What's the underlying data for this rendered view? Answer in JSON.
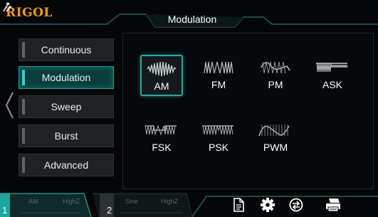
{
  "header": {
    "brand": "RIGOL",
    "title": "Modulation"
  },
  "nav": {
    "items": [
      {
        "label": "Continuous",
        "active": false
      },
      {
        "label": "Modulation",
        "active": true
      },
      {
        "label": "Sweep",
        "active": false
      },
      {
        "label": "Burst",
        "active": false
      },
      {
        "label": "Advanced",
        "active": false
      }
    ]
  },
  "modulation_types": [
    {
      "label": "AM",
      "selected": true
    },
    {
      "label": "FM",
      "selected": false
    },
    {
      "label": "PM",
      "selected": false
    },
    {
      "label": "ASK",
      "selected": false
    },
    {
      "label": "FSK",
      "selected": false
    },
    {
      "label": "PSK",
      "selected": false
    },
    {
      "label": "PWM",
      "selected": false
    }
  ],
  "channels": [
    {
      "number": "1",
      "mode": "AM",
      "load": "HighZ",
      "active": true
    },
    {
      "number": "2",
      "mode": "Sine",
      "load": "HighZ",
      "active": false
    }
  ],
  "colors": {
    "brand": "#f29a1c",
    "accent": "#2fd2c6",
    "active_bg": "#0a3e3d"
  },
  "icons": {
    "header": "sync-arrows-icon",
    "bottom": [
      "document-icon",
      "gear-icon",
      "return-icon",
      "printer-icon"
    ]
  }
}
